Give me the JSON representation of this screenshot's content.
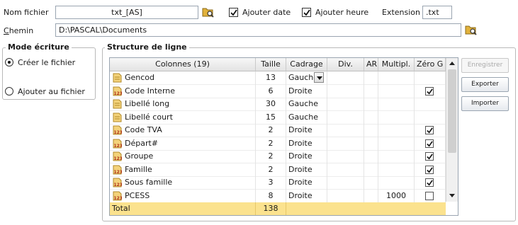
{
  "form": {
    "nom_fichier_label": "Nom fichier",
    "nom_fichier_value": "txt_[AS]",
    "ajouter_date_label": "Ajouter date",
    "ajouter_date_checked": true,
    "ajouter_heure_label": "Ajouter heure",
    "ajouter_heure_checked": true,
    "extension_label": "Extension",
    "extension_value": ".txt",
    "chemin_label_first": "C",
    "chemin_label_rest": "hemin",
    "chemin_value": "D:\\PASCAL\\Documents"
  },
  "mode_ecriture": {
    "title": "Mode écriture",
    "options": [
      {
        "label": "Créer le fichier",
        "selected": true
      },
      {
        "label": "Ajouter au fichier",
        "selected": false
      }
    ]
  },
  "structure": {
    "title": "Structure de ligne",
    "headers": {
      "colonnes": "Colonnes (19)",
      "taille": "Taille",
      "cadrage": "Cadrage",
      "div": "Div.",
      "ar": "AR",
      "multipl": "Multipl.",
      "zero": "Zéro G"
    },
    "rows": [
      {
        "name": "Gencod",
        "icon": "text-field-icon",
        "taille": "13",
        "cadrage": "Gauche",
        "multipl": "",
        "zero": false,
        "zero_shown": false,
        "dropdown": true
      },
      {
        "name": "Code Interne",
        "icon": "numeric-field-icon",
        "taille": "6",
        "cadrage": "Droite",
        "multipl": "",
        "zero": true,
        "zero_shown": true
      },
      {
        "name": "Libellé long",
        "icon": "text-field-icon",
        "taille": "30",
        "cadrage": "Gauche",
        "multipl": "",
        "zero": false,
        "zero_shown": false
      },
      {
        "name": "Libellé court",
        "icon": "text-field-icon",
        "taille": "15",
        "cadrage": "Gauche",
        "multipl": "",
        "zero": false,
        "zero_shown": false
      },
      {
        "name": "Code TVA",
        "icon": "numeric-field-icon",
        "taille": "2",
        "cadrage": "Droite",
        "multipl": "",
        "zero": true,
        "zero_shown": true
      },
      {
        "name": "Départ#",
        "icon": "numeric-field-icon",
        "taille": "2",
        "cadrage": "Droite",
        "multipl": "",
        "zero": true,
        "zero_shown": true
      },
      {
        "name": "Groupe",
        "icon": "numeric-field-icon",
        "taille": "2",
        "cadrage": "Droite",
        "multipl": "",
        "zero": true,
        "zero_shown": true
      },
      {
        "name": "Famille",
        "icon": "numeric-field-icon",
        "taille": "2",
        "cadrage": "Droite",
        "multipl": "",
        "zero": true,
        "zero_shown": true
      },
      {
        "name": "Sous famille",
        "icon": "numeric-field-icon",
        "taille": "3",
        "cadrage": "Droite",
        "multipl": "",
        "zero": true,
        "zero_shown": true
      },
      {
        "name": "PCESS",
        "icon": "numeric-field-icon",
        "taille": "8",
        "cadrage": "Droite",
        "multipl": "1000",
        "zero": false,
        "zero_shown": true
      }
    ],
    "total_label": "Total",
    "total_value": "138"
  },
  "buttons": {
    "enregistrer": "Enregistrer",
    "exporter": "Exporter",
    "importer": "Importer"
  },
  "colors": {
    "total_row": "#fbe28e",
    "folder_icon": "#e2b23c"
  }
}
